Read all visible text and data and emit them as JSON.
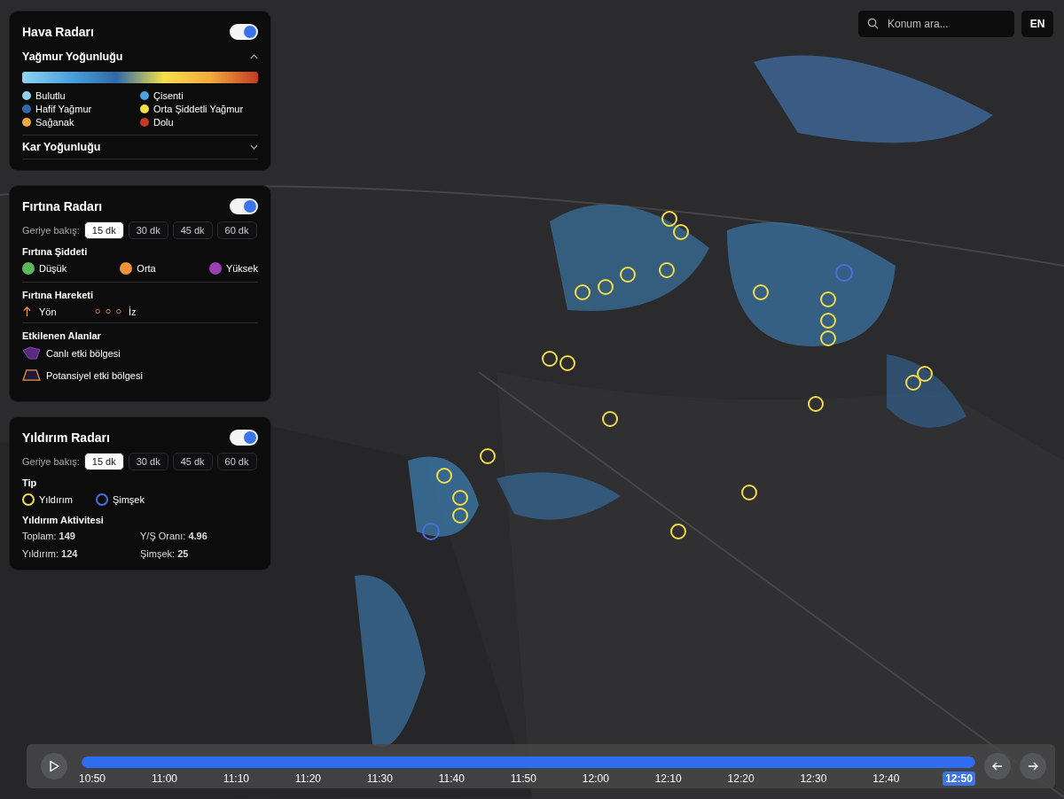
{
  "search": {
    "placeholder": "Konum ara..."
  },
  "language_button": "EN",
  "weather_radar": {
    "title": "Hava Radarı",
    "on": true,
    "rain": {
      "title": "Yağmur Yoğunluğu",
      "expanded": true,
      "legend": [
        {
          "label": "Bulutlu",
          "color": "#8fd3f0"
        },
        {
          "label": "Çisenti",
          "color": "#4aa3df"
        },
        {
          "label": "Hafif Yağmur",
          "color": "#2f6aa8"
        },
        {
          "label": "Orta Şiddetli Yağmur",
          "color": "#f5e04a"
        },
        {
          "label": "Sağanak",
          "color": "#f2a93b"
        },
        {
          "label": "Dolu",
          "color": "#c43a25"
        }
      ]
    },
    "snow": {
      "title": "Kar Yoğunluğu",
      "expanded": false
    }
  },
  "storm_radar": {
    "title": "Fırtına Radarı",
    "on": true,
    "lookback_label": "Geriye bakış:",
    "lookback": [
      {
        "label": "15 dk",
        "selected": true
      },
      {
        "label": "30 dk",
        "selected": false
      },
      {
        "label": "45 dk",
        "selected": false
      },
      {
        "label": "60 dk",
        "selected": false
      }
    ],
    "severity_title": "Fırtına Şiddeti",
    "severity": [
      {
        "label": "Düşük",
        "color": "#5cb85c"
      },
      {
        "label": "Orta",
        "color": "#f0923a"
      },
      {
        "label": "Yüksek",
        "color": "#9b3fb5"
      }
    ],
    "movement_title": "Fırtına Hareketi",
    "direction_label": "Yön",
    "track_label": "İz",
    "areas_title": "Etkilenen Alanlar",
    "areas": [
      {
        "kind": "live",
        "label": "Canlı etki bölgesi"
      },
      {
        "kind": "potential",
        "label": "Potansiyel etki bölgesi"
      }
    ]
  },
  "lightning_radar": {
    "title": "Yıldırım Radarı",
    "on": true,
    "lookback_label": "Geriye bakış:",
    "lookback": [
      {
        "label": "15 dk",
        "selected": true
      },
      {
        "label": "30 dk",
        "selected": false
      },
      {
        "label": "45 dk",
        "selected": false
      },
      {
        "label": "60 dk",
        "selected": false
      }
    ],
    "type_title": "Tip",
    "types": [
      {
        "label": "Yıldırım",
        "color": "#f2dc4a"
      },
      {
        "label": "Şimşek",
        "color": "#4a6fd8"
      }
    ],
    "activity_title": "Yıldırım Aktivitesi",
    "stats": [
      "Toplam: **149**",
      "Y/Ş Oranı: **4.96**",
      "Yıldırım: **124**",
      "Şimşek: **25**"
    ]
  },
  "timeline": {
    "playing": false,
    "level": 1,
    "times": [
      {
        "label": "10:50",
        "selected": false
      },
      {
        "label": "11:00",
        "selected": false
      },
      {
        "label": "11:10",
        "selected": false
      },
      {
        "label": "11:20",
        "selected": false
      },
      {
        "label": "11:30",
        "selected": false
      },
      {
        "label": "11:40",
        "selected": false
      },
      {
        "label": "11:50",
        "selected": false
      },
      {
        "label": "12:00",
        "selected": false
      },
      {
        "label": "12:10",
        "selected": false
      },
      {
        "label": "12:20",
        "selected": false
      },
      {
        "label": "12:30",
        "selected": false
      },
      {
        "label": "12:40",
        "selected": false
      },
      {
        "label": "12:50",
        "selected": true
      }
    ]
  }
}
